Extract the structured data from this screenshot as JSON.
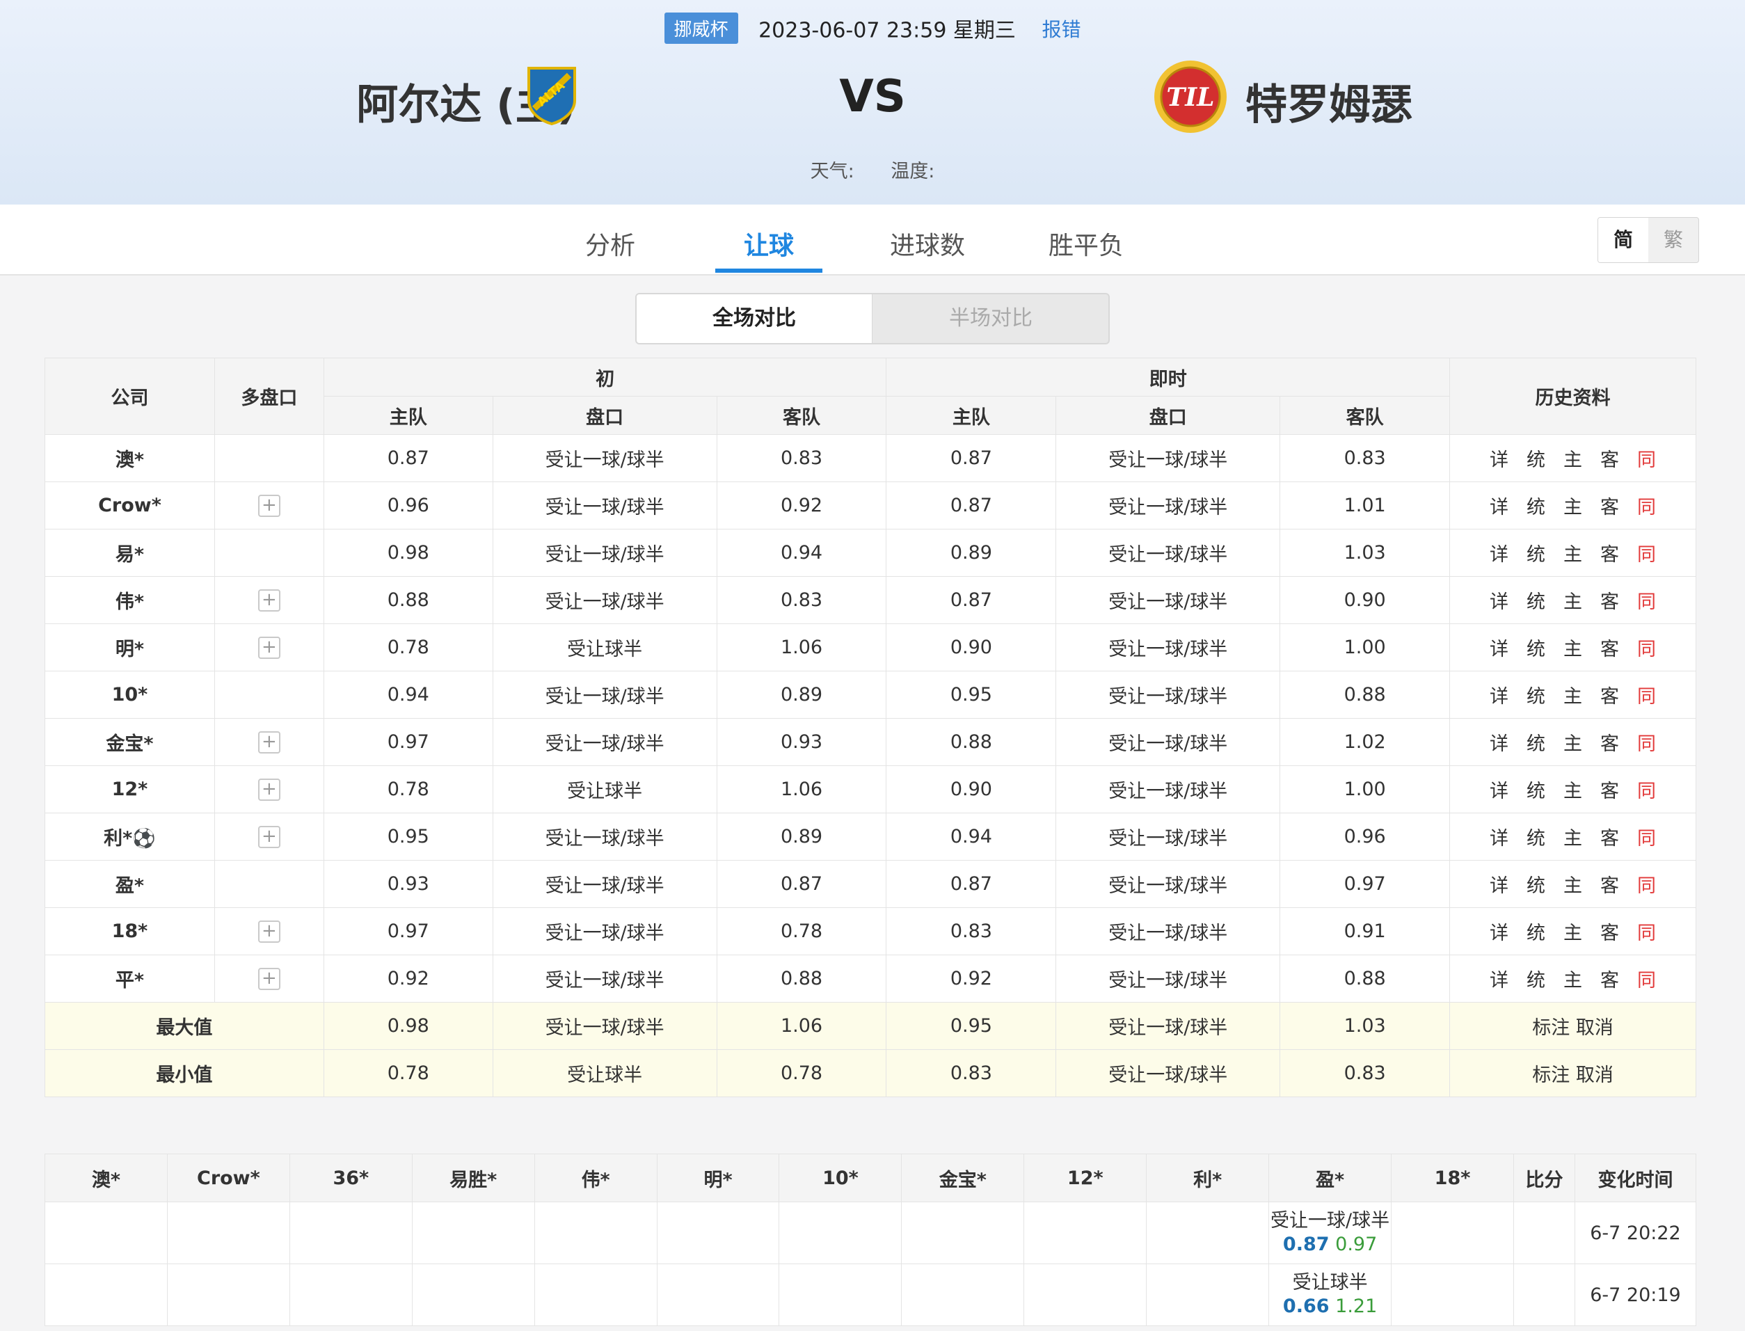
{
  "header": {
    "competition": "挪威杯",
    "datetime": "2023-06-07 23:59 星期三",
    "report": "报错",
    "home_team": "阿尔达 (主)",
    "away_team": "特罗姆瑟",
    "vs": "VS",
    "weather_label": "天气:",
    "temp_label": "温度:",
    "home_logo_text": "ALTA I.F.",
    "away_logo_text": "TIL"
  },
  "tabs": [
    "分析",
    "让球",
    "进球数",
    "胜平负"
  ],
  "active_tab": "让球",
  "lang": {
    "simplified": "简",
    "traditional": "繁"
  },
  "segment": {
    "full": "全场对比",
    "half": "半场对比"
  },
  "odds_table": {
    "head": {
      "company": "公司",
      "multi": "多盘口",
      "initial": "初",
      "live": "即时",
      "history": "历史资料",
      "home": "主队",
      "line": "盘口",
      "away": "客队"
    },
    "history_links": {
      "detail": "详",
      "stats": "统",
      "home": "主",
      "away": "客",
      "same": "同"
    },
    "rows": [
      {
        "company": "澳*",
        "multi": false,
        "i_home": "0.87",
        "i_line": "受让一球/球半",
        "i_away": "0.83",
        "l_home": "0.87",
        "l_line": "受让一球/球半",
        "l_away": "0.83"
      },
      {
        "company": "Crow*",
        "multi": true,
        "i_home": "0.96",
        "i_line": "受让一球/球半",
        "i_away": "0.92",
        "l_home": "0.87",
        "l_line": "受让一球/球半",
        "l_away": "1.01"
      },
      {
        "company": "易*",
        "multi": false,
        "i_home": "0.98",
        "i_line": "受让一球/球半",
        "i_away": "0.94",
        "l_home": "0.89",
        "l_line": "受让一球/球半",
        "l_away": "1.03"
      },
      {
        "company": "伟*",
        "multi": true,
        "i_home": "0.88",
        "i_line": "受让一球/球半",
        "i_away": "0.83",
        "l_home": "0.87",
        "l_line": "受让一球/球半",
        "l_away": "0.90"
      },
      {
        "company": "明*",
        "multi": true,
        "i_home": "0.78",
        "i_line": "受让球半",
        "i_away": "1.06",
        "l_home": "0.90",
        "l_line": "受让一球/球半",
        "l_away": "1.00"
      },
      {
        "company": "10*",
        "multi": false,
        "i_home": "0.94",
        "i_line": "受让一球/球半",
        "i_away": "0.89",
        "l_home": "0.95",
        "l_line": "受让一球/球半",
        "l_away": "0.88"
      },
      {
        "company": "金宝*",
        "multi": true,
        "i_home": "0.97",
        "i_line": "受让一球/球半",
        "i_away": "0.93",
        "l_home": "0.88",
        "l_line": "受让一球/球半",
        "l_away": "1.02"
      },
      {
        "company": "12*",
        "multi": true,
        "i_home": "0.78",
        "i_line": "受让球半",
        "i_away": "1.06",
        "l_home": "0.90",
        "l_line": "受让一球/球半",
        "l_away": "1.00"
      },
      {
        "company": "利*⚽",
        "multi": true,
        "i_home": "0.95",
        "i_line": "受让一球/球半",
        "i_away": "0.89",
        "l_home": "0.94",
        "l_line": "受让一球/球半",
        "l_away": "0.96"
      },
      {
        "company": "盈*",
        "multi": false,
        "i_home": "0.93",
        "i_line": "受让一球/球半",
        "i_away": "0.87",
        "l_home": "0.87",
        "l_line": "受让一球/球半",
        "l_away": "0.97"
      },
      {
        "company": "18*",
        "multi": true,
        "i_home": "0.97",
        "i_line": "受让一球/球半",
        "i_away": "0.78",
        "l_home": "0.83",
        "l_line": "受让一球/球半",
        "l_away": "0.91"
      },
      {
        "company": "平*",
        "multi": true,
        "i_home": "0.92",
        "i_line": "受让一球/球半",
        "i_away": "0.88",
        "l_home": "0.92",
        "l_line": "受让一球/球半",
        "l_away": "0.88"
      }
    ],
    "summary": [
      {
        "label": "最大值",
        "i_home": "0.98",
        "i_line": "受让一球/球半",
        "i_away": "1.06",
        "l_home": "0.95",
        "l_line": "受让一球/球半",
        "l_away": "1.03",
        "actions": "标注 取消"
      },
      {
        "label": "最小值",
        "i_home": "0.78",
        "i_line": "受让球半",
        "i_away": "0.78",
        "l_home": "0.83",
        "l_line": "受让一球/球半",
        "l_away": "0.83",
        "actions": "标注 取消"
      }
    ]
  },
  "change_table": {
    "headers": [
      "澳*",
      "Crow*",
      "36*",
      "易胜*",
      "伟*",
      "明*",
      "10*",
      "金宝*",
      "12*",
      "利*",
      "盈*",
      "18*",
      "比分",
      "变化时间"
    ],
    "rows": [
      {
        "col": 10,
        "line": "受让一球/球半",
        "home": "0.87",
        "away": "0.97",
        "time": "6-7 20:22"
      },
      {
        "col": 10,
        "line": "受让球半",
        "home": "0.66",
        "away": "1.21",
        "time": "6-7 20:19"
      }
    ]
  }
}
